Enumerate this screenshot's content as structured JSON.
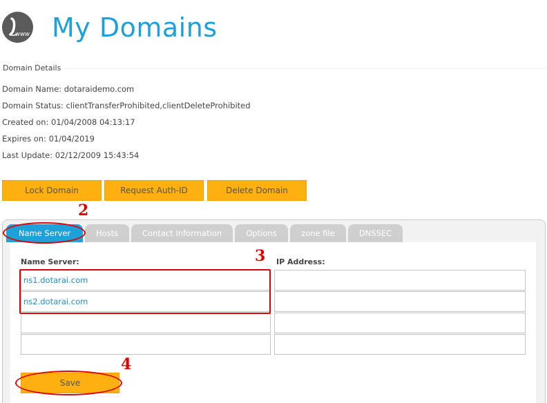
{
  "header": {
    "logo_icon": "www-pen-logo-icon",
    "logo_text": "www",
    "title": "My Domains",
    "title_color": "#1da1d8"
  },
  "details": {
    "section_title": "Domain Details",
    "domain_name": "Domain Name: dotaraidemo.com",
    "domain_status": "Domain Status: clientTransferProhibited,clientDeleteProhibited",
    "created_on": "Created on: 01/04/2008 04:13:17",
    "expires_on": "Expires on: 01/04/2019",
    "last_update": "Last Update: 02/12/2009 15:43:54"
  },
  "actions": {
    "lock": "Lock Domain",
    "request_auth": "Request Auth-ID",
    "delete": "Delete Domain",
    "button_color": "#fdb010"
  },
  "tabs": [
    {
      "label": "Name Server",
      "active": true
    },
    {
      "label": "Hosts"
    },
    {
      "label": "Contact Information"
    },
    {
      "label": "Options"
    },
    {
      "label": "zone file"
    },
    {
      "label": "DNSSEC"
    }
  ],
  "form": {
    "ns_label": "Name Server:",
    "ip_label": "IP Address:",
    "name_servers": [
      "ns1.dotarai.com",
      "ns2.dotarai.com",
      "",
      ""
    ],
    "ip_addresses": [
      "",
      "",
      "",
      ""
    ],
    "save_label": "Save"
  },
  "annotations": {
    "num_2": "2",
    "num_3": "3",
    "num_4": "4",
    "color": "#e00000"
  }
}
